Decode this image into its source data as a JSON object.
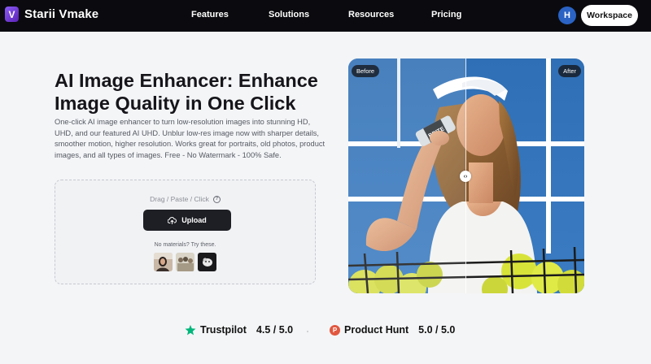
{
  "nav": {
    "brand": "Starii Vmake",
    "links": [
      "Features",
      "Solutions",
      "Resources",
      "Pricing"
    ],
    "avatar_initial": "H",
    "workspace_label": "Workspace",
    "logo_glyph": "V"
  },
  "hero": {
    "title": "AI Image Enhancer: Enhance Image Quality in One Click",
    "description": "One-click AI image enhancer to turn low-resolution images into stunning HD, UHD, and our featured AI UHD. Unblur low-res image now with sharper details, smoother motion, higher resolution. Works great for portraits, old photos, product images, and all types of images. Free - No Watermark - 100% Safe."
  },
  "upload": {
    "hint": "Drag / Paste / Click",
    "button_label": "Upload",
    "sample_hint": "No materials? Try these."
  },
  "compare": {
    "before_label": "Before",
    "after_label": "After",
    "can_text": "BRITE"
  },
  "ratings": {
    "trustpilot_name": "Trustpilot",
    "trustpilot_score": "4.5 / 5.0",
    "producthunt_name": "Product Hunt",
    "producthunt_score": "5.0 / 5.0",
    "producthunt_glyph": "P"
  },
  "colors": {
    "nav_bg": "#0b0b0f",
    "accent_purple": "#7c3aed",
    "trustpilot_green": "#00b67a",
    "producthunt_orange": "#e1573f",
    "avatar_blue": "#2a63c4",
    "upload_button": "#1e1f24"
  }
}
